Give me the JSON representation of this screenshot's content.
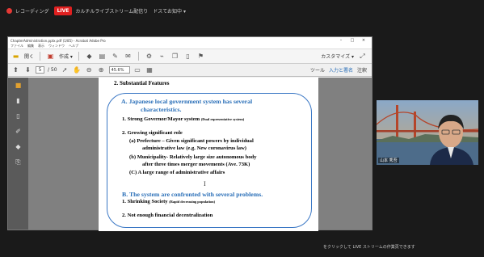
{
  "zoom_bar": {
    "recording_label": "レコーディング",
    "live_badge": "LIVE",
    "live_status": "カルチルライブストリーム配信り　ドスてお知中 ▾"
  },
  "app": {
    "title": "ChapterAdministration.pptx.pdf (1/85) - Acrobat Adobe Pro",
    "menu": [
      "ファイル",
      "編集",
      "表示",
      "ウィンドウ",
      "ヘルプ"
    ],
    "toolbar1": {
      "open": "開く",
      "create": "作成 ▾",
      "customize": "カスタマイズ ▾"
    },
    "toolbar2": {
      "page_current": "5",
      "page_total": "/ 50",
      "zoom": "45.6%",
      "right": [
        "ツール",
        "入力と署名",
        "注釈"
      ]
    }
  },
  "slide": {
    "section": "2. Substantial Features",
    "heading_a_1": "A.  Japanese  local government system has several",
    "heading_a_2": "characteristics.",
    "item1": "1. Strong Governor/Mayor system",
    "item1_note": "(Dual representative system)",
    "item2": "2. Growing significant role",
    "item2a_1": "(a) Prefecture – Given significant powers by individual",
    "item2a_2": "administrative law (e.g. New coronavirus law)",
    "item2b_1": "(b) Municipality- Relatively large size autonomous body",
    "item2b_2": "after three times merger movements (Ave. 73K)",
    "item2c": "(C) A large range of administrative affairs",
    "heading_b": "B. The system are confronted with several problems.",
    "b1": "1.  Shrinking Society",
    "b1_note": "(Rapid decreasing population)",
    "b2": "2. Not enough financial decentralization"
  },
  "video": {
    "name": "山本 秀吾"
  },
  "bottom_note": "をクリックして LIVE ストリームの作業頁できます"
}
